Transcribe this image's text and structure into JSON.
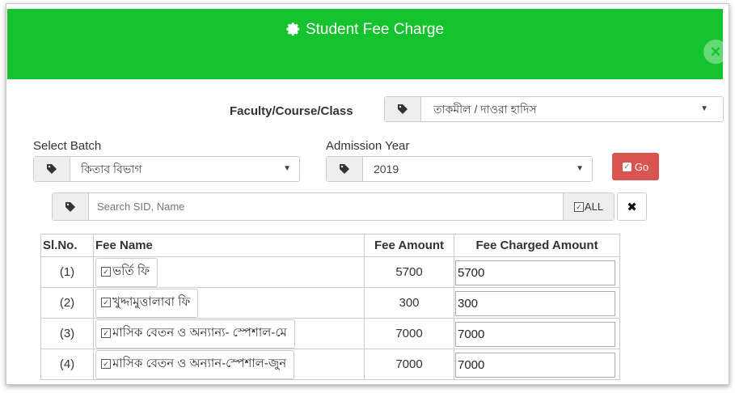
{
  "header": {
    "title": "Student Fee Charge",
    "title_icon": "gear-icon",
    "background": "#15c32e"
  },
  "faculty": {
    "label": "Faculty/Course/Class",
    "value": "তাকমীল / দাওরা হাদিস"
  },
  "batch": {
    "label": "Select Batch",
    "value": "কিতাব বিভাগ"
  },
  "admission": {
    "label": "Admission Year",
    "value": "2019"
  },
  "go_button": {
    "label": "Go",
    "color": "#d9534f"
  },
  "search": {
    "placeholder": "Search SID, Name",
    "value": "",
    "all_label": "ALL",
    "all_checked": true
  },
  "table": {
    "headers": {
      "sl": "Sl.No.",
      "fee_name": "Fee Name",
      "fee_amount": "Fee Amount",
      "charged": "Fee Charged Amount"
    },
    "rows": [
      {
        "sl": "(1)",
        "fee_name": "ভর্তি ফি",
        "amount": "5700",
        "charged": "5700",
        "checked": true
      },
      {
        "sl": "(2)",
        "fee_name": "খুদ্দামুত্তালাবা ফি",
        "amount": "300",
        "charged": "300",
        "checked": true
      },
      {
        "sl": "(3)",
        "fee_name": "মাসিক বেতন ও অন্যান্য- স্পেশাল-মে",
        "amount": "7000",
        "charged": "7000",
        "checked": true
      },
      {
        "sl": "(4)",
        "fee_name": "মাসিক বেতন ও অন্যান-স্পেশাল-জুন",
        "amount": "7000",
        "charged": "7000",
        "checked": true
      }
    ]
  }
}
